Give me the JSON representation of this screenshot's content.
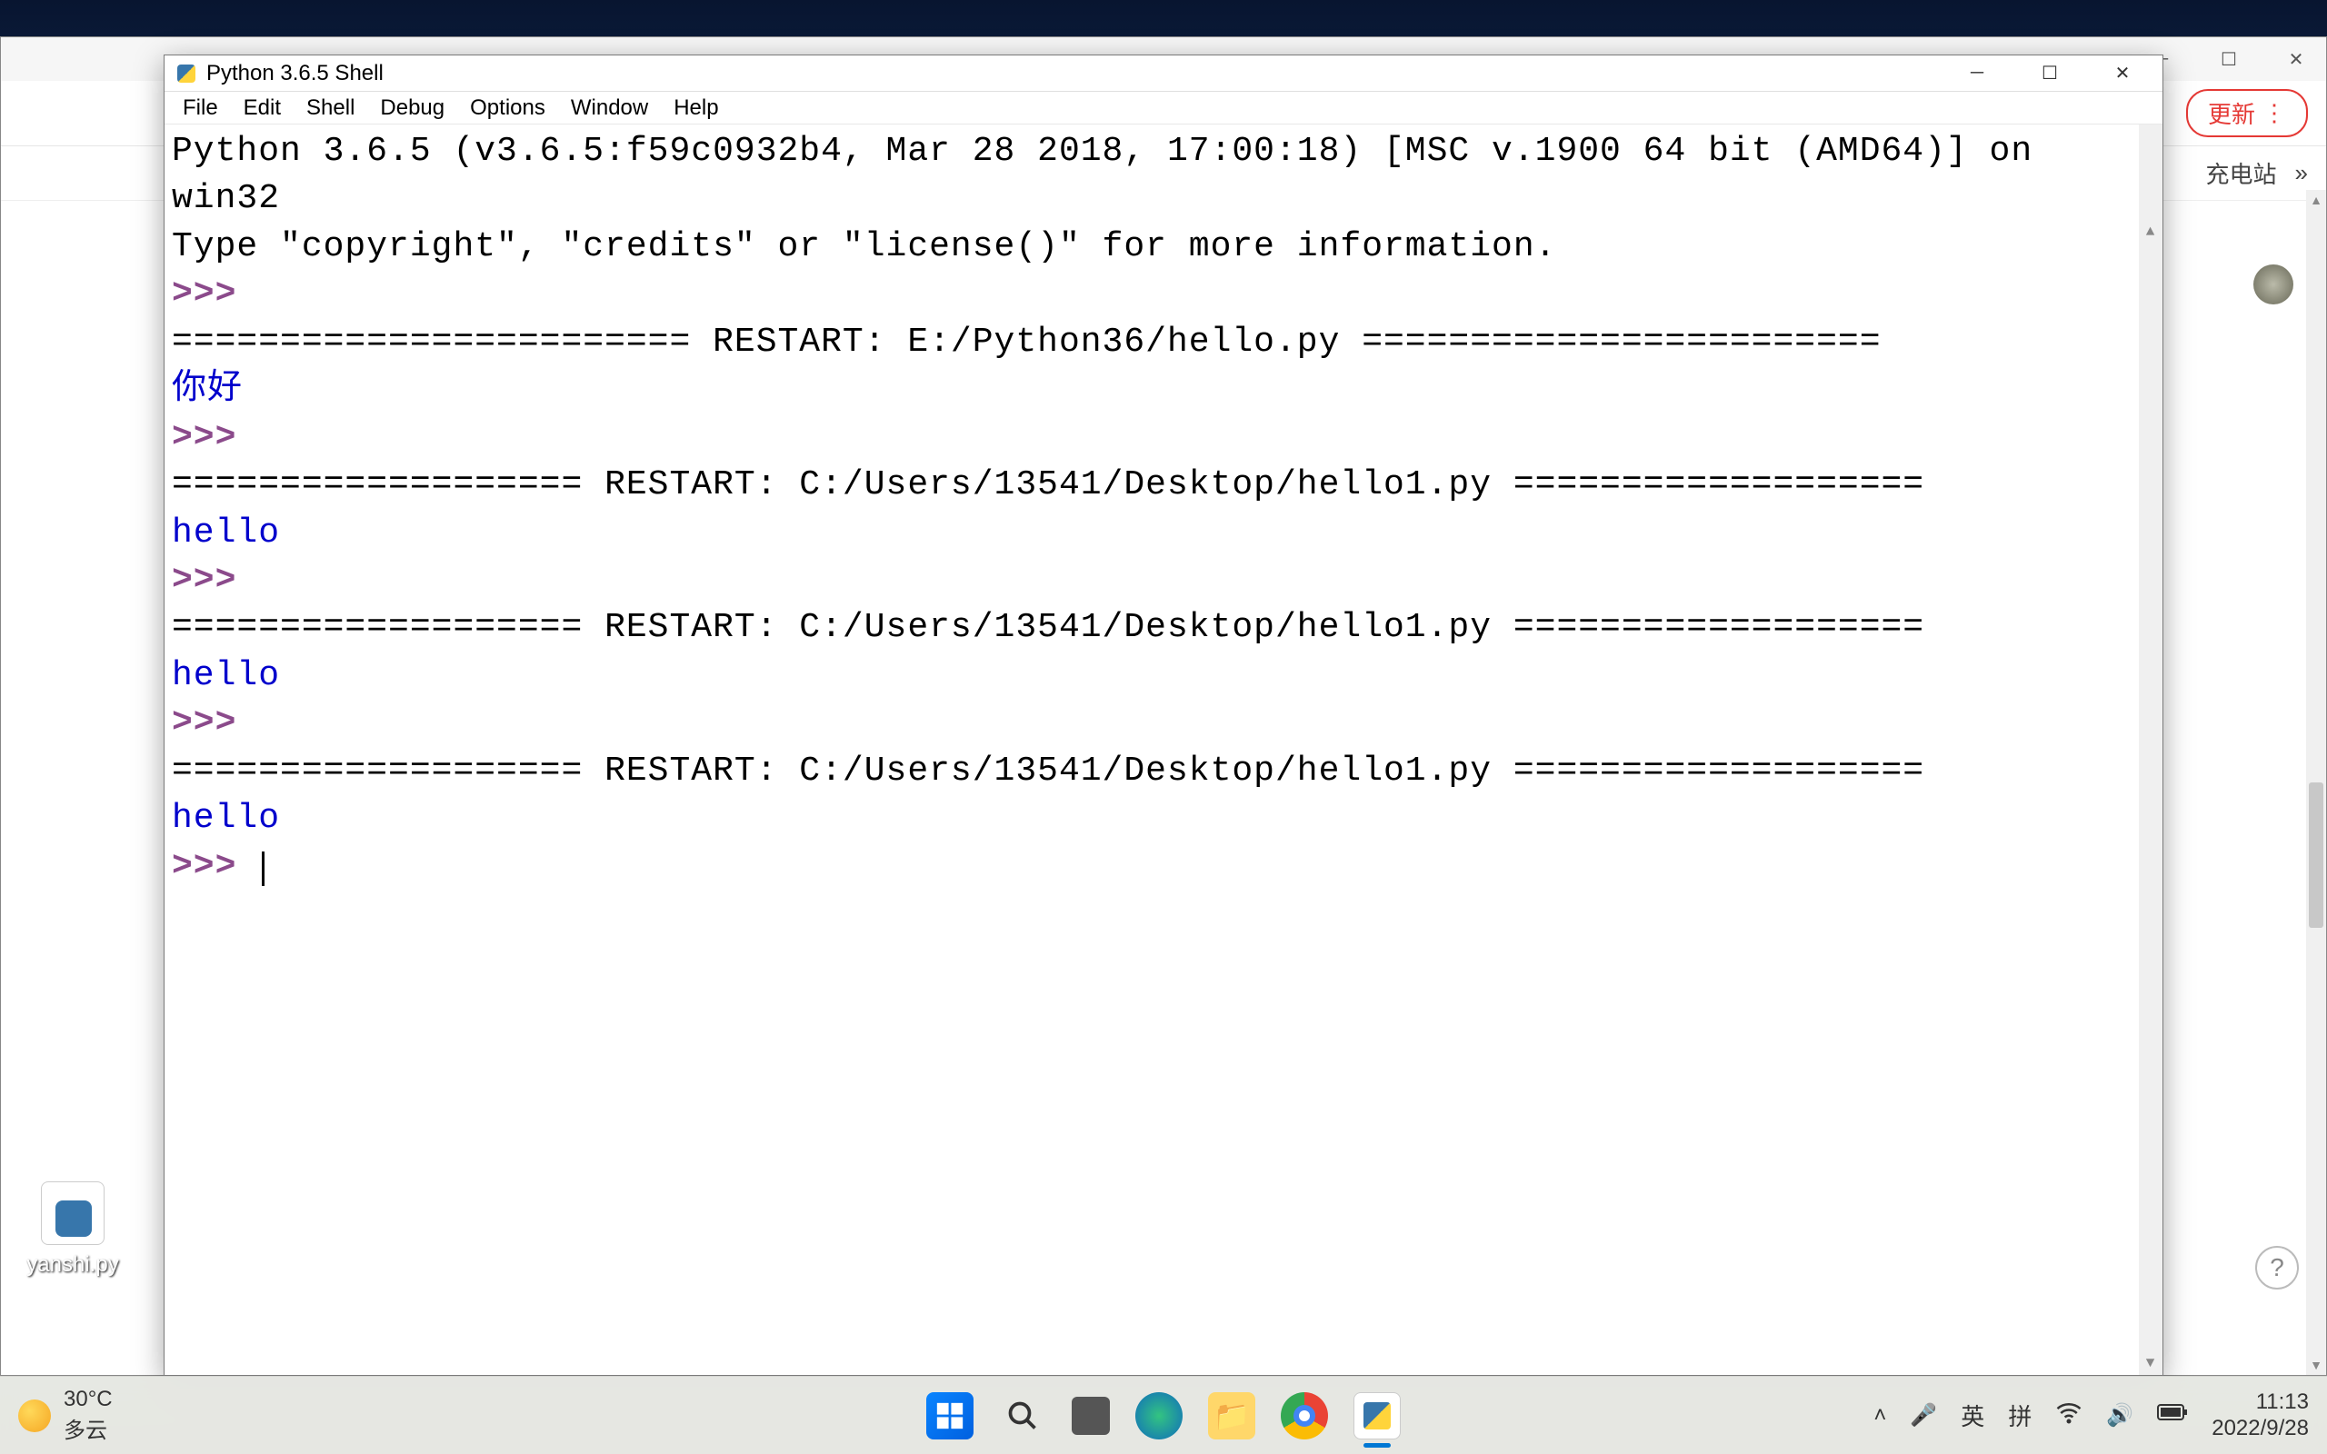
{
  "desktop": {
    "icon_label": "yanshi.py"
  },
  "bg_window": {
    "update_label": "更新",
    "extra_label": "充电站",
    "extra_more": "»"
  },
  "idle": {
    "title": "Python 3.6.5 Shell",
    "menu": [
      "File",
      "Edit",
      "Shell",
      "Debug",
      "Options",
      "Window",
      "Help"
    ],
    "banner_line1": "Python 3.6.5 (v3.6.5:f59c0932b4, Mar 28 2018, 17:00:18) [MSC v.1900 64 bit (AMD64)] on win32",
    "banner_line2": "Type \"copyright\", \"credits\" or \"license()\" for more information.",
    "prompt": ">>> ",
    "restart1": "======================== RESTART: E:/Python36/hello.py ========================",
    "out1": "你好",
    "restart2": "=================== RESTART: C:/Users/13541/Desktop/hello1.py ===================",
    "out2": "hello",
    "restart3": "=================== RESTART: C:/Users/13541/Desktop/hello1.py ===================",
    "out3": "hello",
    "restart4": "=================== RESTART: C:/Users/13541/Desktop/hello1.py ===================",
    "out4": "hello"
  },
  "taskbar": {
    "temp": "30°C",
    "weather": "多云",
    "lang1": "英",
    "lang2": "拼",
    "time": "11:13",
    "date": "2022/9/28"
  }
}
